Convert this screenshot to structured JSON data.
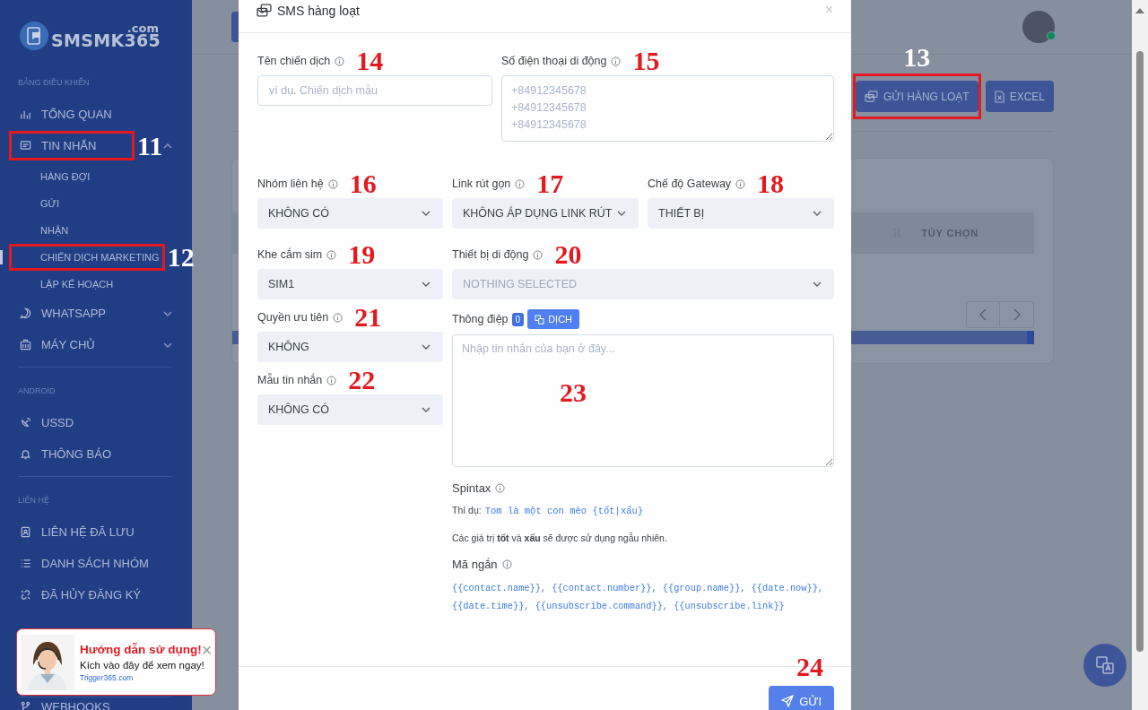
{
  "sidebar": {
    "logo": {
      "name": "SMSMK365",
      "suffix": ".com"
    },
    "sections": [
      {
        "heading": "BẢNG ĐIỀU KHIỂN",
        "items": [
          {
            "label": "TỔNG QUAN",
            "kind": "link"
          },
          {
            "label": "TIN NHẮN",
            "kind": "group",
            "expanded": true,
            "annotation": {
              "number": "11",
              "boxed": true
            },
            "children": [
              {
                "label": "HÀNG ĐỢI",
                "selected": false
              },
              {
                "label": "GỬI",
                "selected": false
              },
              {
                "label": "NHẬN",
                "selected": false
              },
              {
                "label": "CHIẾN DỊCH MARKETING",
                "selected": true,
                "annotation": {
                  "number": "12",
                  "boxed": true
                }
              },
              {
                "label": "LẬP KẾ HOẠCH",
                "selected": false
              }
            ]
          },
          {
            "label": "WHATSAPP",
            "kind": "group",
            "expanded": false
          },
          {
            "label": "MÁY CHỦ",
            "kind": "group",
            "expanded": false
          }
        ]
      },
      {
        "heading": "ANDROID",
        "items": [
          {
            "label": "USSD",
            "kind": "link"
          },
          {
            "label": "THÔNG BÁO",
            "kind": "link"
          }
        ]
      },
      {
        "heading": "LIÊN HỆ",
        "items": [
          {
            "label": "LIÊN HỆ ĐÃ LƯU",
            "kind": "link"
          },
          {
            "label": "DANH SÁCH NHÓM",
            "kind": "link"
          },
          {
            "label": "ĐÃ HỦY ĐĂNG KÝ",
            "kind": "link"
          }
        ]
      },
      {
        "items": [
          {
            "label": "WEBHOOKS",
            "kind": "link"
          }
        ]
      }
    ]
  },
  "main": {
    "avatar": {
      "online": true
    },
    "actions": [
      {
        "label": "GỬI HÀNG LOẠT",
        "annotation": {
          "number": "13",
          "boxed": true
        }
      },
      {
        "label": "EXCEL"
      }
    ],
    "table": {
      "columns": [
        {
          "label": "TÙY CHỌN"
        }
      ]
    }
  },
  "modal": {
    "title": "SMS hàng loạt",
    "close": "×",
    "fields": [
      {
        "label": "Tên chiến dịch",
        "kind": "text",
        "placeholder": "ví dụ. Chiến dịch mẫu",
        "annotation": {
          "number": "14",
          "boxed": false
        }
      },
      {
        "label": "Số điện thoại di động",
        "kind": "lines",
        "placeholder": "+84912345678\n+84912345678\n+84912345678",
        "annotation": {
          "number": "15",
          "boxed": false
        }
      },
      {
        "label": "Nhóm liên hệ",
        "kind": "select",
        "value": "KHÔNG CÓ",
        "annotation": {
          "number": "16",
          "boxed": false
        }
      },
      {
        "label": "Link rút gọn",
        "kind": "select",
        "value": "KHÔNG ÁP DỤNG LINK RÚT",
        "annotation": {
          "number": "17",
          "boxed": false
        }
      },
      {
        "label": "Chế độ Gateway",
        "kind": "select",
        "value": "THIẾT BỊ",
        "annotation": {
          "number": "18",
          "boxed": false
        }
      },
      {
        "label": "Khe cắm sim",
        "kind": "select",
        "value": "SIM1",
        "annotation": {
          "number": "19",
          "boxed": false
        }
      },
      {
        "label": "Thiết bị di động",
        "kind": "select",
        "placeholder": "NOTHING SELECTED",
        "annotation": {
          "number": "20",
          "boxed": false
        }
      },
      {
        "label": "Quyền ưu tiên",
        "kind": "select",
        "value": "KHÔNG",
        "annotation": {
          "number": "21",
          "boxed": false
        }
      },
      {
        "label": "Mẫu tin nhắn",
        "kind": "select",
        "value": "KHÔNG CÓ",
        "annotation": {
          "number": "22",
          "boxed": false
        }
      }
    ],
    "message": {
      "label": "Thông điệp",
      "count": "0",
      "translate_button": "DỊCH",
      "placeholder": "Nhập tin nhắn của bạn ở đây...",
      "annotation": {
        "number": "23",
        "boxed": false
      }
    },
    "spintax": {
      "title": "Spintax",
      "example_label": "Thí dụ:",
      "example": "Tom là một con mèo {tốt|xấu}",
      "note": "Các giá trị **tốt** và **xấu** sẽ được sử dụng ngẫu nhiên."
    },
    "shortcodes": {
      "title": "Mã ngắn",
      "codes": "{{contact.name}}, {{contact.number}}, {{group.name}}, {{date.now}}, {{date.time}}, {{unsubscribe.command}}, {{unsubscribe.link}}"
    },
    "submit": {
      "label": "GỬI",
      "annotation": {
        "number": "24",
        "boxed": false
      }
    }
  },
  "popup": {
    "title": "Hướng dẫn sử dụng!",
    "close": "×",
    "text": "Kích vào đây để xem ngay!",
    "link": "Trigger365.com"
  }
}
